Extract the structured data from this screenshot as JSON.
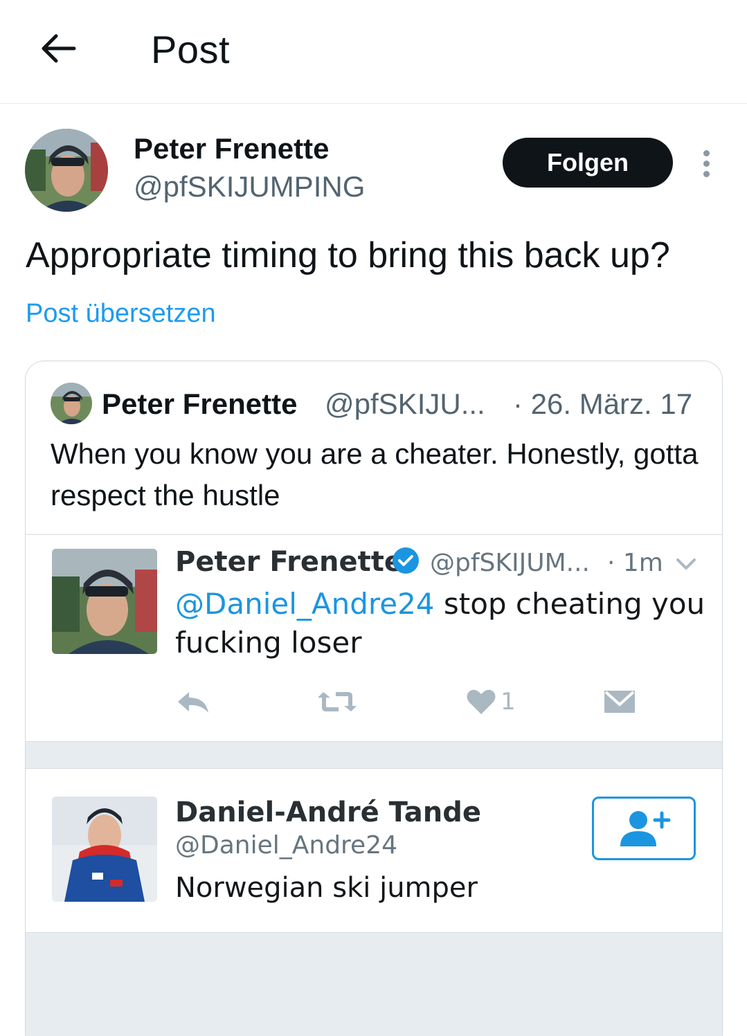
{
  "header": {
    "title": "Post"
  },
  "author": {
    "name": "Peter Frenette",
    "handle": "@pfSKIJUMPING",
    "follow_label": "Folgen"
  },
  "post": {
    "text": "Appropriate timing to bring this back up?",
    "translate_label": "Post übersetzen"
  },
  "quote": {
    "name": "Peter Frenette",
    "handle": "@pfSKIJU...",
    "date": "· 26. März. 17",
    "text": "When you know you are a cheater. Honestly, gotta respect the hustle"
  },
  "screenshot": {
    "tweet": {
      "name": "Peter Frenette",
      "handle": "@pfSKIJUM...",
      "time": "· 1m",
      "mention": "@Daniel_Andre24",
      "text_rest": " stop cheating you fucking loser",
      "like_count": "1"
    },
    "suggested_user": {
      "name": "Daniel-André Tande",
      "handle": "@Daniel_Andre24",
      "bio": "Norwegian ski jumper"
    }
  },
  "colors": {
    "accent": "#1d9bf0",
    "text_primary": "#0f1419",
    "text_secondary": "#536471",
    "follow_button_bg": "#0f1419",
    "old_twitter_blue": "#1b95e0"
  }
}
